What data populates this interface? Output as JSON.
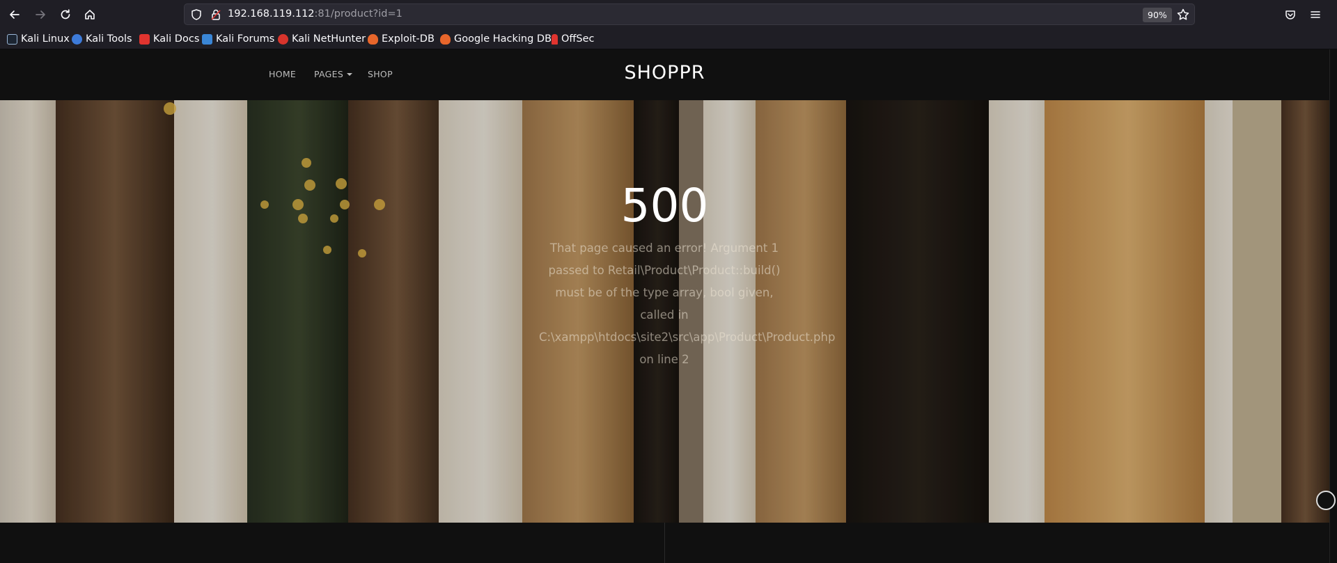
{
  "browser": {
    "url_host": "192.168.119.112",
    "url_rest": ":81/product?id=1",
    "zoom": "90%",
    "bookmarks": [
      {
        "label": "Kali Linux",
        "icon": "kali-dragon-icon",
        "color": "#9bb8d8"
      },
      {
        "label": "Kali Tools",
        "icon": "kali-tools-icon",
        "color": "#3d7bd9"
      },
      {
        "label": "Kali Docs",
        "icon": "kali-docs-icon",
        "color": "#e0342f"
      },
      {
        "label": "Kali Forums",
        "icon": "kali-forums-icon",
        "color": "#3a86d6"
      },
      {
        "label": "Kali NetHunter",
        "icon": "nethunter-icon",
        "color": "#d8342c"
      },
      {
        "label": "Exploit-DB",
        "icon": "exploit-db-icon",
        "color": "#e8662b"
      },
      {
        "label": "Google Hacking DB",
        "icon": "ghdb-icon",
        "color": "#e8662b"
      },
      {
        "label": "OffSec",
        "icon": "offsec-icon",
        "color": "#e0342f"
      }
    ]
  },
  "site": {
    "brand": "SHOPPR",
    "nav": {
      "home": "HOME",
      "pages": "PAGES",
      "shop": "SHOP"
    }
  },
  "error": {
    "code": "500",
    "message": "That page caused an error! Argument 1 passed to Retail\\Product\\Product::build() must be of the type array, bool given, called in C:\\xampp\\htdocs\\site2\\src\\app\\Product\\Product.php on line 2"
  }
}
